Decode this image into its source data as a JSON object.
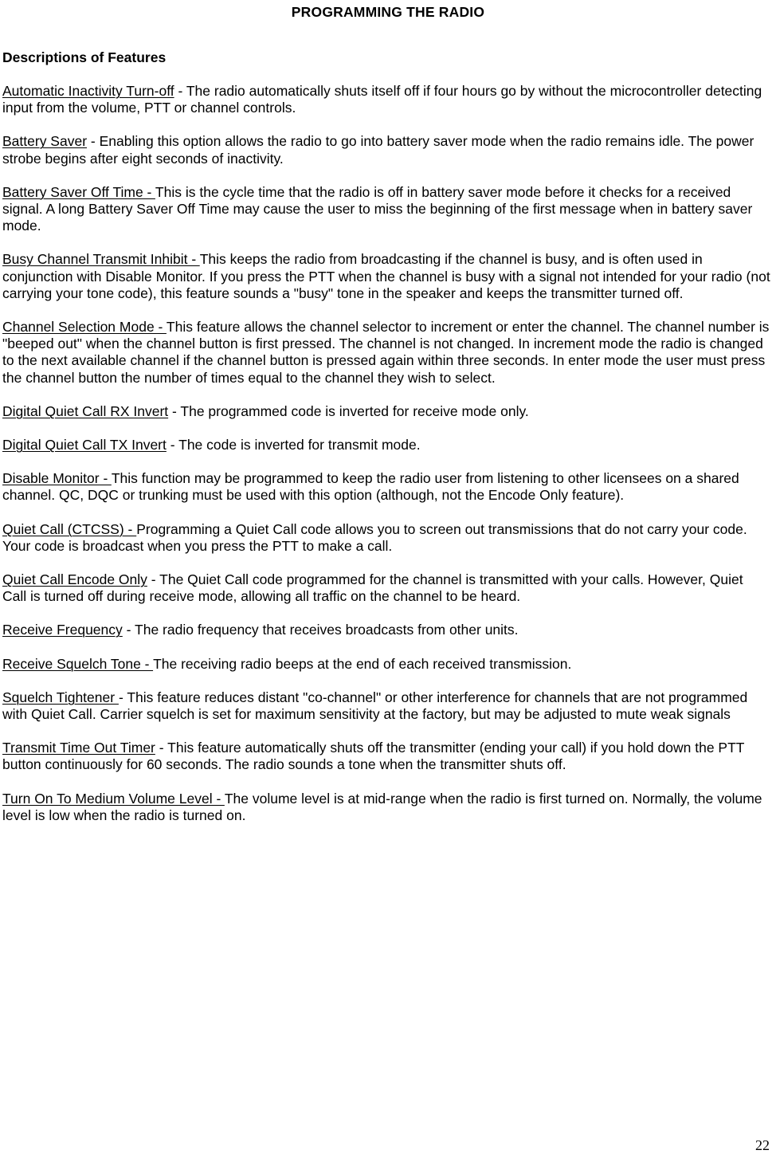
{
  "document": {
    "title": "PROGRAMMING THE RADIO",
    "section_heading": "Descriptions of Features",
    "page_number": "22",
    "features": [
      {
        "term": "Automatic Inactivity Turn-off",
        "separator": " - ",
        "description": "The radio automatically shuts itself off if four hours go by without the microcontroller detecting input from the volume, PTT or channel controls."
      },
      {
        "term": "Battery Saver",
        "separator": " - ",
        "description": "Enabling this option allows the radio to go into battery saver mode when the radio remains idle.  The power strobe begins after eight seconds of inactivity."
      },
      {
        "term": "Battery Saver Off Time - ",
        "separator": "",
        "description": "This is the cycle time that the radio is off in battery saver mode before it checks for a received signal.  A long Battery Saver Off Time may cause the user to miss the beginning of the first message when in battery saver mode."
      },
      {
        "term": "Busy Channel Transmit Inhibit - ",
        "separator": "",
        "description": "This keeps the radio from broadcasting if the channel is busy, and is often used in conjunction with Disable Monitor.  If you press the PTT when the channel is busy with a signal not intended for your radio (not carrying your tone code), this feature sounds a \"busy\" tone in the speaker and keeps the transmitter turned off."
      },
      {
        "term": "Channel Selection Mode - ",
        "separator": "",
        "description": "This feature allows the channel selector to increment or enter the channel.  The channel number is \"beeped out\" when the channel button is first pressed. The channel is not changed. In increment mode the radio is changed to the next available channel if the channel button is pressed again within three seconds.  In enter mode the user must press the channel button the number of times equal to the channel they wish to select."
      },
      {
        "term": "Digital Quiet Call RX Invert",
        "separator": " - ",
        "description": "The programmed code is inverted for receive mode only."
      },
      {
        "term": "Digital Quiet Call TX Invert",
        "separator": " - ",
        "description": "The code is inverted for transmit mode."
      },
      {
        "term": "Disable Monitor - ",
        "separator": "",
        "description": "This function may be programmed to keep the radio user from listening to other licensees on a shared channel.  QC, DQC or trunking must be used with this option (although, not the Encode Only feature)."
      },
      {
        "term": "Quiet Call (CTCSS) - ",
        "separator": "",
        "description": "Programming a Quiet Call code allows you to screen out transmissions that do not carry your code.  Your code is broadcast when you press the PTT to make a call."
      },
      {
        "term": "Quiet Call Encode Only",
        "separator": " - ",
        "description": "The Quiet Call code programmed for the channel is transmitted with your calls.  However, Quiet Call is turned off during receive mode, allowing all traffic on the channel to be heard."
      },
      {
        "term": "Receive Frequency",
        "separator": " - ",
        "description": "The radio frequency that receives broadcasts from other units."
      },
      {
        "term": "Receive Squelch Tone - ",
        "separator": "",
        "description": "The receiving radio beeps at the end of each received transmission."
      },
      {
        "term": "Squelch Tightener  ",
        "separator": "- ",
        "description": "This feature reduces distant \"co-channel\" or other interference for channels that are not programmed with Quiet Call.  Carrier squelch is set for maximum sensitivity at the factory, but may be adjusted to mute weak signals"
      },
      {
        "term": "Transmit Time Out Timer",
        "separator": " - ",
        "description": "This feature automatically shuts off the transmitter (ending your call) if you hold down the PTT button continuously for 60 seconds.  The radio sounds a tone when the transmitter shuts off."
      },
      {
        "term": "Turn On To Medium Volume Level - ",
        "separator": "",
        "description": "The volume level is at mid-range when the radio is first turned on.  Normally, the volume level is low when the radio is turned on."
      }
    ]
  }
}
